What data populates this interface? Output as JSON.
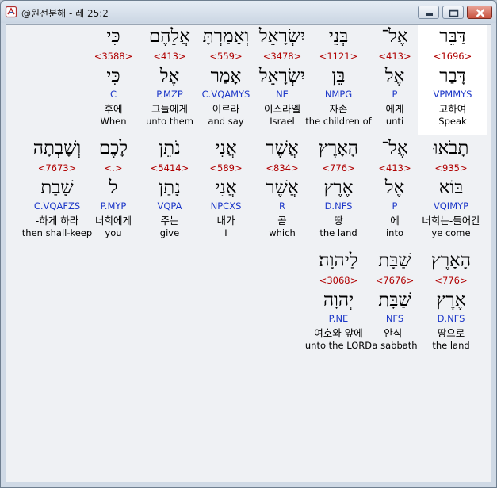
{
  "window": {
    "title": "@원전분해 - 레 25:2",
    "buttons": {
      "minimize": "minimize",
      "maximize": "maximize",
      "close": "close"
    }
  },
  "colors": {
    "number": "#b00000",
    "parse": "#1c37c8",
    "highlight": "#ffffff"
  },
  "icons": {
    "app": "book-icon",
    "minimize": "minimize-icon",
    "maximize": "maximize-icon",
    "close": "close-icon"
  },
  "rows": [
    {
      "words": [
        {
          "hebrew": "דַּבֵּר",
          "number": "<1696>",
          "root": "דָּבַר",
          "parse": "VPMMYS",
          "korean": "고하여",
          "english": "Speak",
          "highlighted": true
        },
        {
          "hebrew": "אֶל־",
          "number": "<413>",
          "root": "אֶל",
          "parse": "P",
          "korean": "에게",
          "english": "unti"
        },
        {
          "hebrew": "בְּנֵי",
          "number": "<1121>",
          "root": "בֵּן",
          "parse": "NMPG",
          "korean": "자손",
          "english": "the children of"
        },
        {
          "hebrew": "יִשְׂרָאֵל",
          "number": "<3478>",
          "root": "יִשְׂרָאֵל",
          "parse": "NE",
          "korean": "이스라엘",
          "english": "Israel"
        },
        {
          "hebrew": "וְאָמַרְתָּ",
          "number": "<559>",
          "root": "אָמַר",
          "parse": "C.VQAMYS",
          "korean": "이르라",
          "english": "and say"
        },
        {
          "hebrew": "אֲלֵהֶם",
          "number": "<413>",
          "root": "אֶל",
          "parse": "P.MZP",
          "korean": "그들에게",
          "english": "unto them"
        },
        {
          "hebrew": "כִּי",
          "number": "<3588>",
          "root": "כִּי",
          "parse": "C",
          "korean": "후에",
          "english": "When"
        }
      ]
    },
    {
      "words": [
        {
          "hebrew": "תָבֹאוּ",
          "number": "<935>",
          "root": "בּוֹא",
          "parse": "VQIMYP",
          "korean": "너희는-들어간",
          "english": "ye come"
        },
        {
          "hebrew": "אֶל־",
          "number": "<413>",
          "root": "אֶל",
          "parse": "P",
          "korean": "에",
          "english": "into"
        },
        {
          "hebrew": "הָאָרֶץ",
          "number": "<776>",
          "root": "אֶרֶץ",
          "parse": "D.NFS",
          "korean": "땅",
          "english": "the land"
        },
        {
          "hebrew": "אֲשֶׁר",
          "number": "<834>",
          "root": "אֲשֶׁר",
          "parse": "R",
          "korean": "곧",
          "english": "which"
        },
        {
          "hebrew": "אֲנִי",
          "number": "<589>",
          "root": "אֲנִי",
          "parse": "NPCXS",
          "korean": "내가",
          "english": "I"
        },
        {
          "hebrew": "נֹתֵן",
          "number": "<5414>",
          "root": "נָתַן",
          "parse": "VQPA",
          "korean": "주는",
          "english": "give"
        },
        {
          "hebrew": "לָכֶם",
          "number": "<.>",
          "root": "ל",
          "parse": "P.MYP",
          "korean": "너희에게",
          "english": "you"
        },
        {
          "hebrew": "וְשָׁבְתָה",
          "number": "<7673>",
          "root": "שָׁבַת",
          "parse": "C.VQAFZS",
          "korean": "-하게 하라",
          "english": "then shall-keep"
        }
      ]
    },
    {
      "words": [
        {
          "hebrew": "הָאָרֶץ",
          "number": "<776>",
          "root": "אֶרֶץ",
          "parse": "D.NFS",
          "korean": "땅으로",
          "english": "the land"
        },
        {
          "hebrew": "שַׁבָּת",
          "number": "<7676>",
          "root": "שַׁבָּת",
          "parse": "NFS",
          "korean": "안식-",
          "english": "a sabbath"
        },
        {
          "hebrew": "לַיהוָה׃",
          "number": "<3068>",
          "root": "יְהוָה",
          "parse": "P.NE",
          "korean": "여호와 앞에",
          "english": "unto the LORD"
        }
      ]
    }
  ]
}
